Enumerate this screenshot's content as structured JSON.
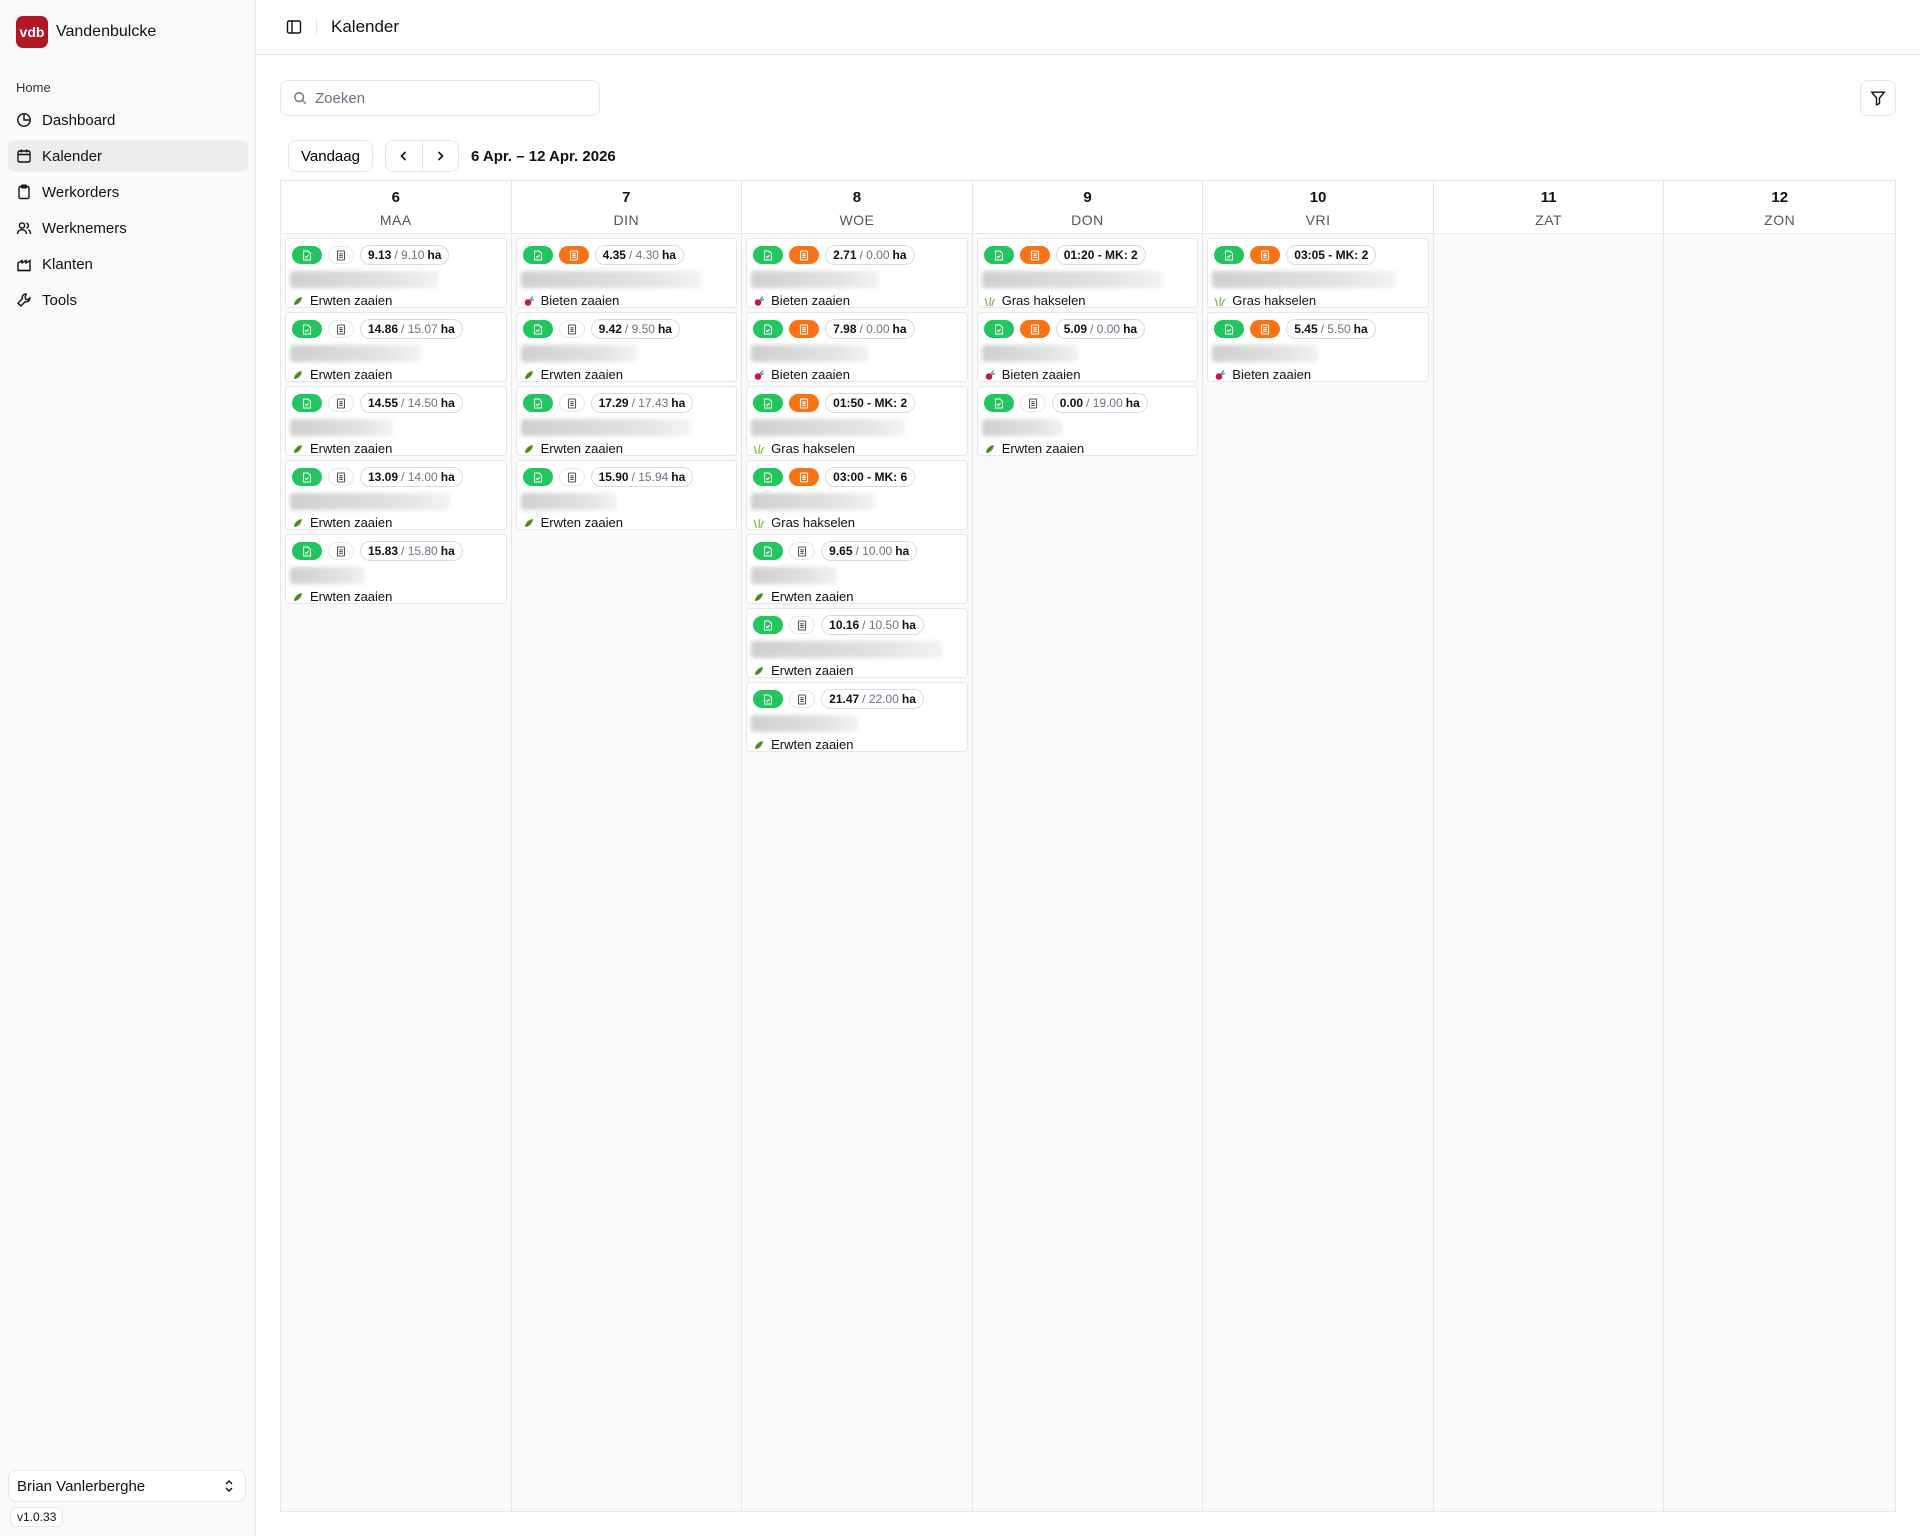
{
  "brand": {
    "name": "Vandenbulcke",
    "logo_text": "vdb"
  },
  "sidebar": {
    "section": "Home",
    "items": [
      {
        "label": "Dashboard",
        "icon": "dashboard-icon",
        "active": false
      },
      {
        "label": "Kalender",
        "icon": "calendar-icon",
        "active": true
      },
      {
        "label": "Werkorders",
        "icon": "clipboard-icon",
        "active": false
      },
      {
        "label": "Werknemers",
        "icon": "users-icon",
        "active": false
      },
      {
        "label": "Klanten",
        "icon": "building-icon",
        "active": false
      },
      {
        "label": "Tools",
        "icon": "wrench-icon",
        "active": false
      }
    ],
    "user": "Brian Vanlerberghe",
    "version": "v1.0.33"
  },
  "header": {
    "title": "Kalender"
  },
  "search": {
    "placeholder": "Zoeken",
    "value": ""
  },
  "calendar": {
    "today_label": "Vandaag",
    "range": "6 Apr. – 12 Apr. 2026",
    "days": [
      {
        "num": "6",
        "name": "MAA",
        "events": [
          {
            "status": "gray",
            "value": "9.13",
            "planned": "/ 9.10",
            "unit": "ha",
            "task": "Erwten zaaien",
            "crop": "pea",
            "blur": 0.7
          },
          {
            "status": "gray",
            "value": "14.86",
            "planned": "/ 15.07",
            "unit": "ha",
            "task": "Erwten zaaien",
            "crop": "pea",
            "blur": 0.62
          },
          {
            "status": "gray",
            "value": "14.55",
            "planned": "/ 14.50",
            "unit": "ha",
            "task": "Erwten zaaien",
            "crop": "pea",
            "blur": 0.48
          },
          {
            "status": "gray",
            "value": "13.09",
            "planned": "/ 14.00",
            "unit": "ha",
            "task": "Erwten zaaien",
            "crop": "pea",
            "blur": 0.75
          },
          {
            "status": "gray",
            "value": "15.83",
            "planned": "/ 15.80",
            "unit": "ha",
            "task": "Erwten zaaien",
            "crop": "pea",
            "blur": 0.35
          }
        ]
      },
      {
        "num": "7",
        "name": "DIN",
        "events": [
          {
            "status": "orange",
            "value": "4.35",
            "planned": "/ 4.30",
            "unit": "ha",
            "task": "Bieten zaaien",
            "crop": "beet",
            "blur": 0.85
          },
          {
            "status": "gray",
            "value": "9.42",
            "planned": "/ 9.50",
            "unit": "ha",
            "task": "Erwten zaaien",
            "crop": "pea",
            "blur": 0.55
          },
          {
            "status": "gray",
            "value": "17.29",
            "planned": "/ 17.43",
            "unit": "ha",
            "task": "Erwten zaaien",
            "crop": "pea",
            "blur": 0.8
          },
          {
            "status": "gray",
            "value": "15.90",
            "planned": "/ 15.94",
            "unit": "ha",
            "task": "Erwten zaaien",
            "crop": "pea",
            "blur": 0.45
          }
        ]
      },
      {
        "num": "8",
        "name": "WOE",
        "events": [
          {
            "status": "orange",
            "value": "2.71",
            "planned": "/ 0.00",
            "unit": "ha",
            "task": "Bieten zaaien",
            "crop": "beet",
            "blur": 0.6
          },
          {
            "status": "orange",
            "value": "7.98",
            "planned": "/ 0.00",
            "unit": "ha",
            "task": "Bieten zaaien",
            "crop": "beet",
            "blur": 0.55
          },
          {
            "status": "orange",
            "value": "01:50 - MK: 2",
            "planned": "",
            "unit": "",
            "task": "Gras hakselen",
            "crop": "grass",
            "blur": 0.72
          },
          {
            "status": "orange",
            "value": "03:00 - MK: 6",
            "planned": "",
            "unit": "",
            "task": "Gras hakselen",
            "crop": "grass",
            "blur": 0.58
          },
          {
            "status": "gray",
            "value": "9.65",
            "planned": "/ 10.00",
            "unit": "ha",
            "task": "Erwten zaaien",
            "crop": "pea",
            "blur": 0.4
          },
          {
            "status": "gray",
            "value": "10.16",
            "planned": "/ 10.50",
            "unit": "ha",
            "task": "Erwten zaaien",
            "crop": "pea",
            "blur": 0.9
          },
          {
            "status": "gray",
            "value": "21.47",
            "planned": "/ 22.00",
            "unit": "ha",
            "task": "Erwten zaaien",
            "crop": "pea",
            "blur": 0.5
          }
        ]
      },
      {
        "num": "9",
        "name": "DON",
        "events": [
          {
            "status": "orange",
            "value": "01:20 - MK: 2",
            "planned": "",
            "unit": "",
            "task": "Gras hakselen",
            "crop": "grass",
            "blur": 0.85
          },
          {
            "status": "orange",
            "value": "5.09",
            "planned": "/ 0.00",
            "unit": "ha",
            "task": "Bieten zaaien",
            "crop": "beet",
            "blur": 0.45
          },
          {
            "status": "gray",
            "value": "0.00",
            "planned": "/ 19.00",
            "unit": "ha",
            "task": "Erwten zaaien",
            "crop": "pea",
            "blur": 0.38
          }
        ]
      },
      {
        "num": "10",
        "name": "VRI",
        "events": [
          {
            "status": "orange",
            "value": "03:05 - MK: 2",
            "planned": "",
            "unit": "",
            "task": "Gras hakselen",
            "crop": "grass",
            "blur": 0.86
          },
          {
            "status": "orange",
            "value": "5.45",
            "planned": "/ 5.50",
            "unit": "ha",
            "task": "Bieten zaaien",
            "crop": "beet",
            "blur": 0.5
          }
        ]
      },
      {
        "num": "11",
        "name": "ZAT",
        "events": []
      },
      {
        "num": "12",
        "name": "ZON",
        "events": []
      }
    ]
  },
  "colors": {
    "green": "#22c55e",
    "orange": "#f97316",
    "brand": "#b0182a"
  }
}
